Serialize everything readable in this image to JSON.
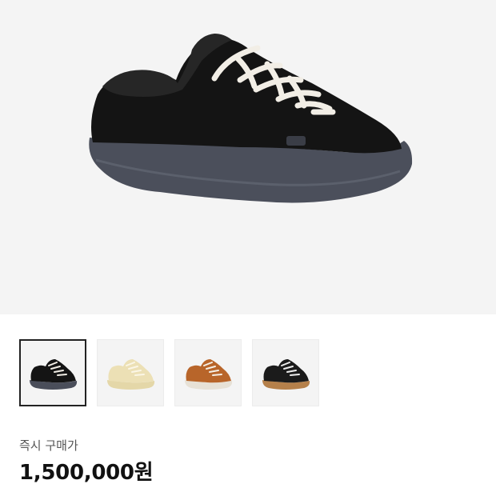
{
  "product": {
    "main_image_icon": "black-fur-sneaker-image",
    "thumbnails": [
      {
        "icon": "black-sneaker-thumb",
        "selected": true,
        "upper": "#141414",
        "sole": "#4a4e5a",
        "lace": "#f2eee6"
      },
      {
        "icon": "cream-sneaker-thumb",
        "selected": false,
        "upper": "#ece0b5",
        "sole": "#e4d7a8",
        "lace": "#fbf6e6"
      },
      {
        "icon": "brown-sneaker-thumb",
        "selected": false,
        "upper": "#b8652a",
        "sole": "#e7e1d6",
        "lace": "#f4efe6"
      },
      {
        "icon": "black-gum-sneaker-thumb",
        "selected": false,
        "upper": "#1b1b1b",
        "sole": "#b5804a",
        "lace": "#eeeeee"
      }
    ],
    "price_label": "즉시 구매가",
    "price": "1,500,000원"
  }
}
